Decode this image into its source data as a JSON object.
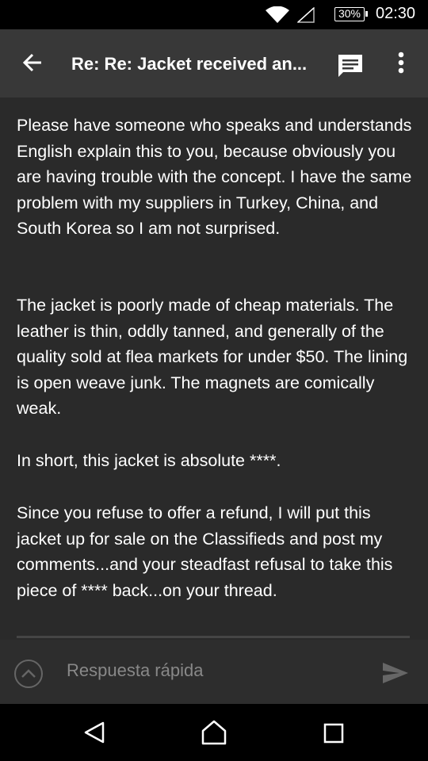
{
  "status": {
    "battery": "30%",
    "time": "02:30"
  },
  "appbar": {
    "title": "Re: Re: Jacket received an..."
  },
  "message": {
    "paragraphs": [
      "Please have someone who speaks and understands English explain this to you, because obviously you are having trouble with the concept. I have the same problem with my suppliers in Turkey, China, and South Korea so I am not surprised.",
      "The jacket is poorly made of cheap materials. The leather is thin, oddly tanned, and generally of the quality sold at flea markets for under $50. The lining is open weave junk. The magnets are comically weak.",
      "In short, this jacket is absolute ****.",
      "Since you refuse to offer a refund, I will put this jacket up for sale on the Classifieds and post my comments...and your steadfast refusal to take this piece of **** back...on your thread."
    ]
  },
  "reply": {
    "placeholder": "Respuesta rápida"
  },
  "icons": {
    "back": "back-arrow-icon",
    "chat": "chat-icon",
    "more": "more-vert-icon",
    "expand": "expand-up-icon",
    "send": "send-icon",
    "nav_back": "nav-back-icon",
    "nav_home": "nav-home-icon",
    "nav_recents": "nav-recents-icon"
  },
  "colors": {
    "appbar": "#383838",
    "content": "#2a2a2a",
    "placeholder": "#888888"
  }
}
